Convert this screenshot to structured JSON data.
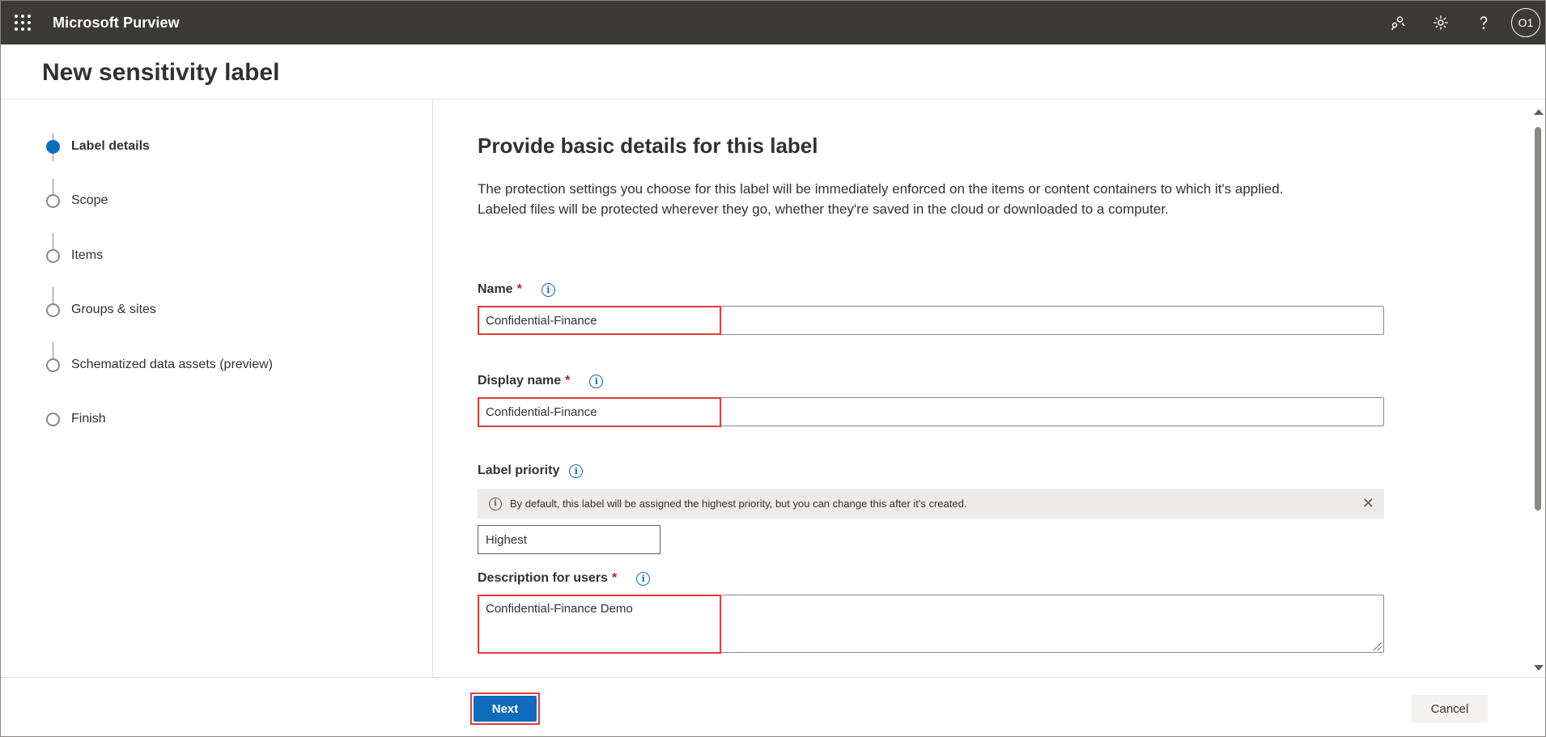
{
  "topbar": {
    "app_title": "Microsoft Purview",
    "icons": [
      "waffle-icon",
      "community-icon",
      "settings-icon",
      "help-icon"
    ],
    "avatar_initials": "O1"
  },
  "page": {
    "title": "New sensitivity label"
  },
  "steps": [
    {
      "label": "Label details",
      "state": "active"
    },
    {
      "label": "Scope",
      "state": "pending"
    },
    {
      "label": "Items",
      "state": "pending"
    },
    {
      "label": "Groups & sites",
      "state": "pending"
    },
    {
      "label": "Schematized data assets (preview)",
      "state": "pending"
    },
    {
      "label": "Finish",
      "state": "pending"
    }
  ],
  "main": {
    "section_title": "Provide basic details for this label",
    "intro_line1": "The protection settings you choose for this label will be immediately enforced on the items or content containers to which it's applied.",
    "intro_line2": "Labeled files will be protected wherever they go, whether they're saved in the cloud or downloaded to a computer.",
    "name": {
      "label": "Name",
      "required": "*",
      "value": "Confidential-Finance"
    },
    "display_name": {
      "label": "Display name",
      "required": "*",
      "value": "Confidential-Finance"
    },
    "priority": {
      "label": "Label priority",
      "notice": "By default, this label will be assigned the highest priority, but you can change this after it's created.",
      "value": "Highest"
    },
    "description": {
      "label": "Description for users",
      "required": "*",
      "value": "Confidential-Finance Demo"
    }
  },
  "footer": {
    "next_label": "Next",
    "cancel_label": "Cancel"
  },
  "colors": {
    "topbar": "#3b3a39",
    "accent": "#0f6cbd",
    "highlight": "#e03c3c",
    "required": "#a4262c"
  }
}
